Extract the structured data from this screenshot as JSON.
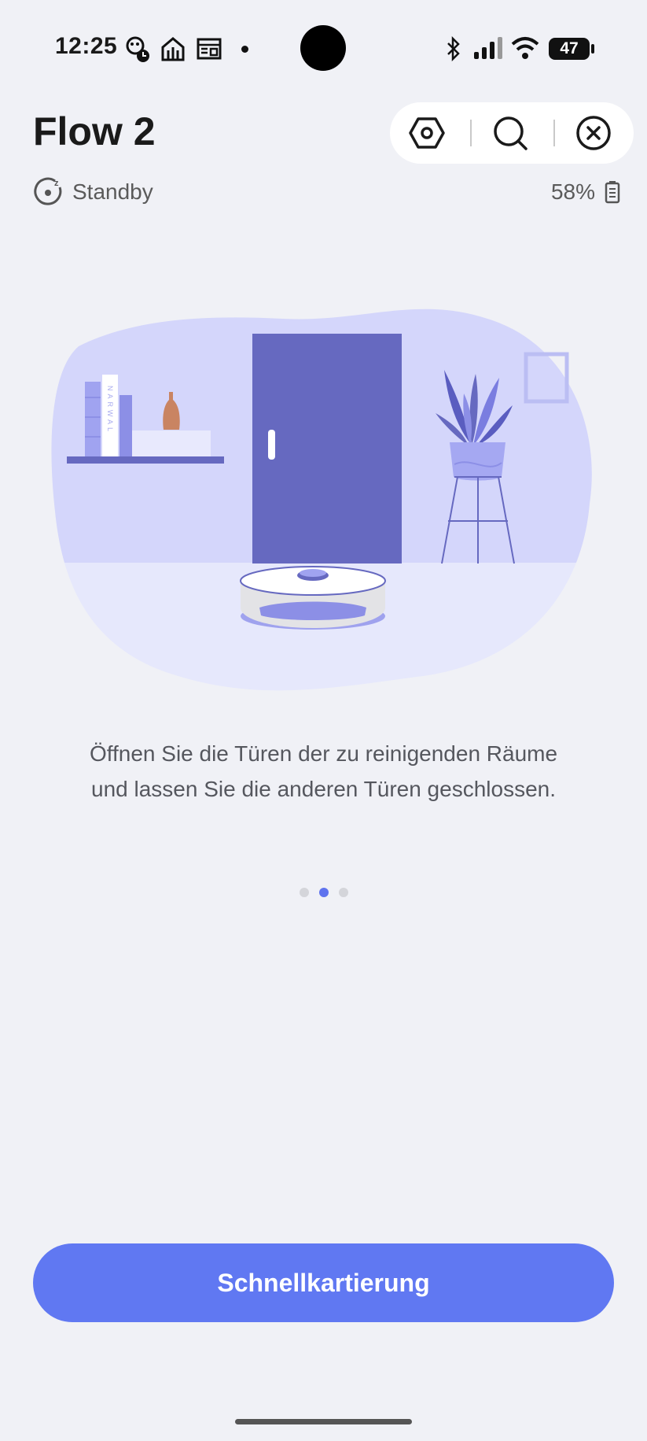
{
  "status_bar": {
    "time": "12:25",
    "battery_level": "47",
    "icons": [
      "game-notification-icon",
      "app-notification-icon",
      "news-notification-icon",
      "more-dot-icon",
      "bluetooth-icon",
      "signal-icon",
      "wifi-icon",
      "battery-icon"
    ]
  },
  "header": {
    "title": "Flow 2",
    "actions": [
      "settings-hex-icon",
      "search-icon",
      "close-circle-icon"
    ]
  },
  "device_status": {
    "state": "Standby",
    "battery": "58%"
  },
  "illustration": {
    "brand_text": "NARWAL",
    "accent_color": "#6669c0"
  },
  "hint": {
    "line1": "Öffnen Sie die Türen der zu reinigenden Räume",
    "line2": "und lassen Sie die anderen Türen geschlossen."
  },
  "pager": {
    "total": 3,
    "active_index": 1
  },
  "primary_action": {
    "label": "Schnellkartierung",
    "color": "#6078f2"
  }
}
